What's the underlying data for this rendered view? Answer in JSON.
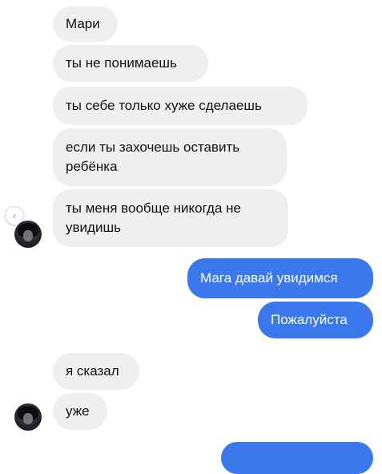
{
  "conversation": {
    "incoming_group_1": [
      "Мари",
      "ты не понимаешь",
      "ты себе только хуже сделаешь",
      "если ты захочешь оставить\nребёнка",
      "ты меня вообще никогда не\nувидишь"
    ],
    "outgoing_group_1": [
      "Мага давай увидимся",
      "Пожалуйста"
    ],
    "incoming_group_2": [
      "я сказал",
      "уже"
    ]
  },
  "icons": {
    "avatar": "avatar-icon",
    "side_control": "chevron-left-icon"
  },
  "colors": {
    "incoming_bubble": "#efeff1",
    "outgoing_bubble": "#3a78ec",
    "background": "#ffffff"
  }
}
